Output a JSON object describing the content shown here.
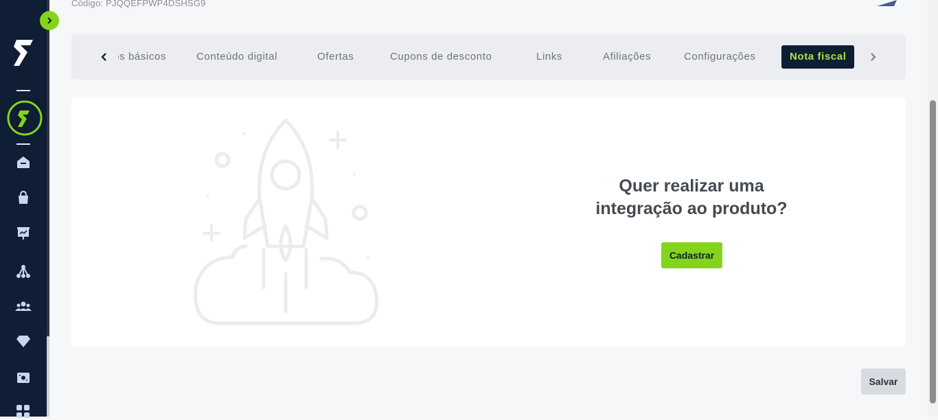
{
  "header": {
    "code_label": "Código: PJQQEFPWP4DSHSG9"
  },
  "sidebar": {
    "expand_icon": "chevron-right-icon",
    "items": [
      {
        "icon": "home-icon"
      },
      {
        "icon": "shopping-bag-icon"
      },
      {
        "icon": "presentation-chart-icon"
      },
      {
        "icon": "network-icon"
      },
      {
        "icon": "users-icon"
      },
      {
        "icon": "diamond-icon"
      },
      {
        "icon": "wallet-icon"
      },
      {
        "icon": "apps-icon"
      }
    ]
  },
  "tabs": {
    "items": [
      {
        "label": "Dados básicos"
      },
      {
        "label": "Conteúdo digital"
      },
      {
        "label": "Ofertas"
      },
      {
        "label": "Cupons de desconto"
      },
      {
        "label": "Links"
      },
      {
        "label": "Afiliações"
      },
      {
        "label": "Configurações"
      },
      {
        "label": "Nota fiscal"
      }
    ],
    "active_index": 7
  },
  "empty_state": {
    "heading_line1": "Quer realizar uma",
    "heading_line2": "integração ao produto?",
    "button_label": "Cadastrar",
    "illustration": "rocket-launch-icon"
  },
  "footer": {
    "save_label": "Salvar"
  },
  "colors": {
    "sidebar_bg": "#0f1d35",
    "accent_green": "#84d51a",
    "active_tab_text": "#a6e44b",
    "page_bg": "#f6f7f9"
  }
}
